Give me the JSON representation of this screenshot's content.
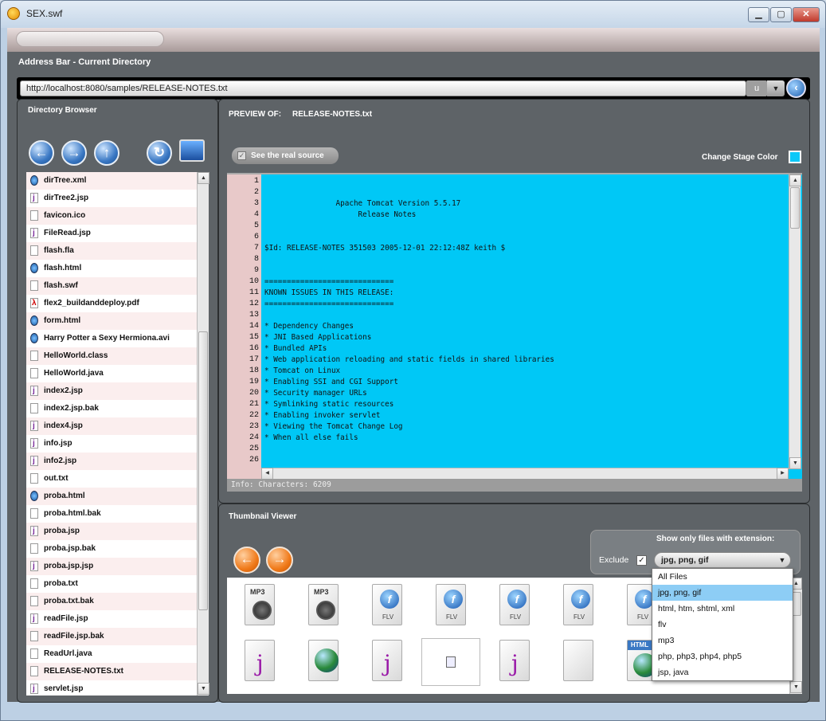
{
  "window": {
    "title": "SEX.swf",
    "min": "▁",
    "max": "▢",
    "close": "✕"
  },
  "address": {
    "section_title": "Address Bar - Current Directory",
    "url": "http://localhost:8080/samples/RELEASE-NOTES.txt",
    "u_label": "u",
    "dropdown": "▼",
    "go": "‹"
  },
  "browser": {
    "title": "Directory Browser",
    "nav": {
      "back": "←",
      "forward": "→",
      "up": "↑",
      "refresh": "↻"
    },
    "files": [
      {
        "name": "dirTree.xml",
        "icon": "globe"
      },
      {
        "name": "dirTree2.jsp",
        "icon": "j"
      },
      {
        "name": "favicon.ico",
        "icon": "doc"
      },
      {
        "name": "FileRead.jsp",
        "icon": "j"
      },
      {
        "name": "flash.fla",
        "icon": "doc"
      },
      {
        "name": "flash.html",
        "icon": "globe"
      },
      {
        "name": "flash.swf",
        "icon": "doc"
      },
      {
        "name": "flex2_buildanddeploy.pdf",
        "icon": "pdf"
      },
      {
        "name": "form.html",
        "icon": "globe"
      },
      {
        "name": "Harry Potter a Sexy Hermiona.avi",
        "icon": "globe"
      },
      {
        "name": "HelloWorld.class",
        "icon": "doc"
      },
      {
        "name": "HelloWorld.java",
        "icon": "doc"
      },
      {
        "name": "index2.jsp",
        "icon": "j"
      },
      {
        "name": "index2.jsp.bak",
        "icon": "doc"
      },
      {
        "name": "index4.jsp",
        "icon": "j"
      },
      {
        "name": "info.jsp",
        "icon": "j"
      },
      {
        "name": "info2.jsp",
        "icon": "j"
      },
      {
        "name": "out.txt",
        "icon": "doc"
      },
      {
        "name": "proba.html",
        "icon": "globe"
      },
      {
        "name": "proba.html.bak",
        "icon": "doc"
      },
      {
        "name": "proba.jsp",
        "icon": "j"
      },
      {
        "name": "proba.jsp.bak",
        "icon": "doc"
      },
      {
        "name": "proba.jsp.jsp",
        "icon": "j"
      },
      {
        "name": "proba.txt",
        "icon": "doc"
      },
      {
        "name": "proba.txt.bak",
        "icon": "doc"
      },
      {
        "name": "readFile.jsp",
        "icon": "j"
      },
      {
        "name": "readFile.jsp.bak",
        "icon": "doc"
      },
      {
        "name": "ReadUrl.java",
        "icon": "doc"
      },
      {
        "name": "RELEASE-NOTES.txt",
        "icon": "doc"
      },
      {
        "name": "servlet.jsp",
        "icon": "j"
      }
    ]
  },
  "preview": {
    "label": "PREVIEW OF:",
    "filename": "RELEASE-NOTES.txt",
    "source_button": "See the real source",
    "stage_color_label": "Change Stage Color",
    "stage_color": "#00c8f6",
    "lines": [
      "",
      "",
      "                Apache Tomcat Version 5.5.17",
      "                     Release Notes",
      "",
      "",
      "$Id: RELEASE-NOTES 351503 2005-12-01 22:12:48Z keith $",
      "",
      "",
      "=============================",
      "KNOWN ISSUES IN THIS RELEASE:",
      "=============================",
      "",
      "* Dependency Changes",
      "* JNI Based Applications",
      "* Bundled APIs",
      "* Web application reloading and static fields in shared libraries",
      "* Tomcat on Linux",
      "* Enabling SSI and CGI Support",
      "* Security manager URLs",
      "* Symlinking static resources",
      "* Enabling invoker servlet",
      "* Viewing the Tomcat Change Log",
      "* When all else fails",
      "",
      ""
    ],
    "info": "Info:  Characters: 6209"
  },
  "thumbs": {
    "title": "Thumbnail Viewer",
    "nav": {
      "back": "←",
      "forward": "→"
    },
    "filter_label": "Show only files with extension:",
    "exclude_label": "Exclude",
    "exclude_checked": "✓",
    "selected_ext": "jpg, png, gif",
    "ext_options": [
      "All Files",
      "jpg, png, gif",
      "html, htm, shtml, xml",
      "flv",
      "mp3",
      "php, php3, php4, php5",
      "jsp, java"
    ],
    "row1": [
      {
        "type": "mp3",
        "label": "MP3"
      },
      {
        "type": "mp3",
        "label": "MP3"
      },
      {
        "type": "flv",
        "label": "FLV"
      },
      {
        "type": "flv",
        "label": "FLV"
      },
      {
        "type": "flv",
        "label": "FLV"
      },
      {
        "type": "flv",
        "label": "FLV"
      },
      {
        "type": "flv",
        "label": "FLV"
      }
    ],
    "row2": [
      {
        "type": "jsp"
      },
      {
        "type": "globe"
      },
      {
        "type": "jsp"
      },
      {
        "type": "broken"
      },
      {
        "type": "jsp"
      },
      {
        "type": "blank"
      },
      {
        "type": "html",
        "label": "HTML"
      }
    ]
  }
}
